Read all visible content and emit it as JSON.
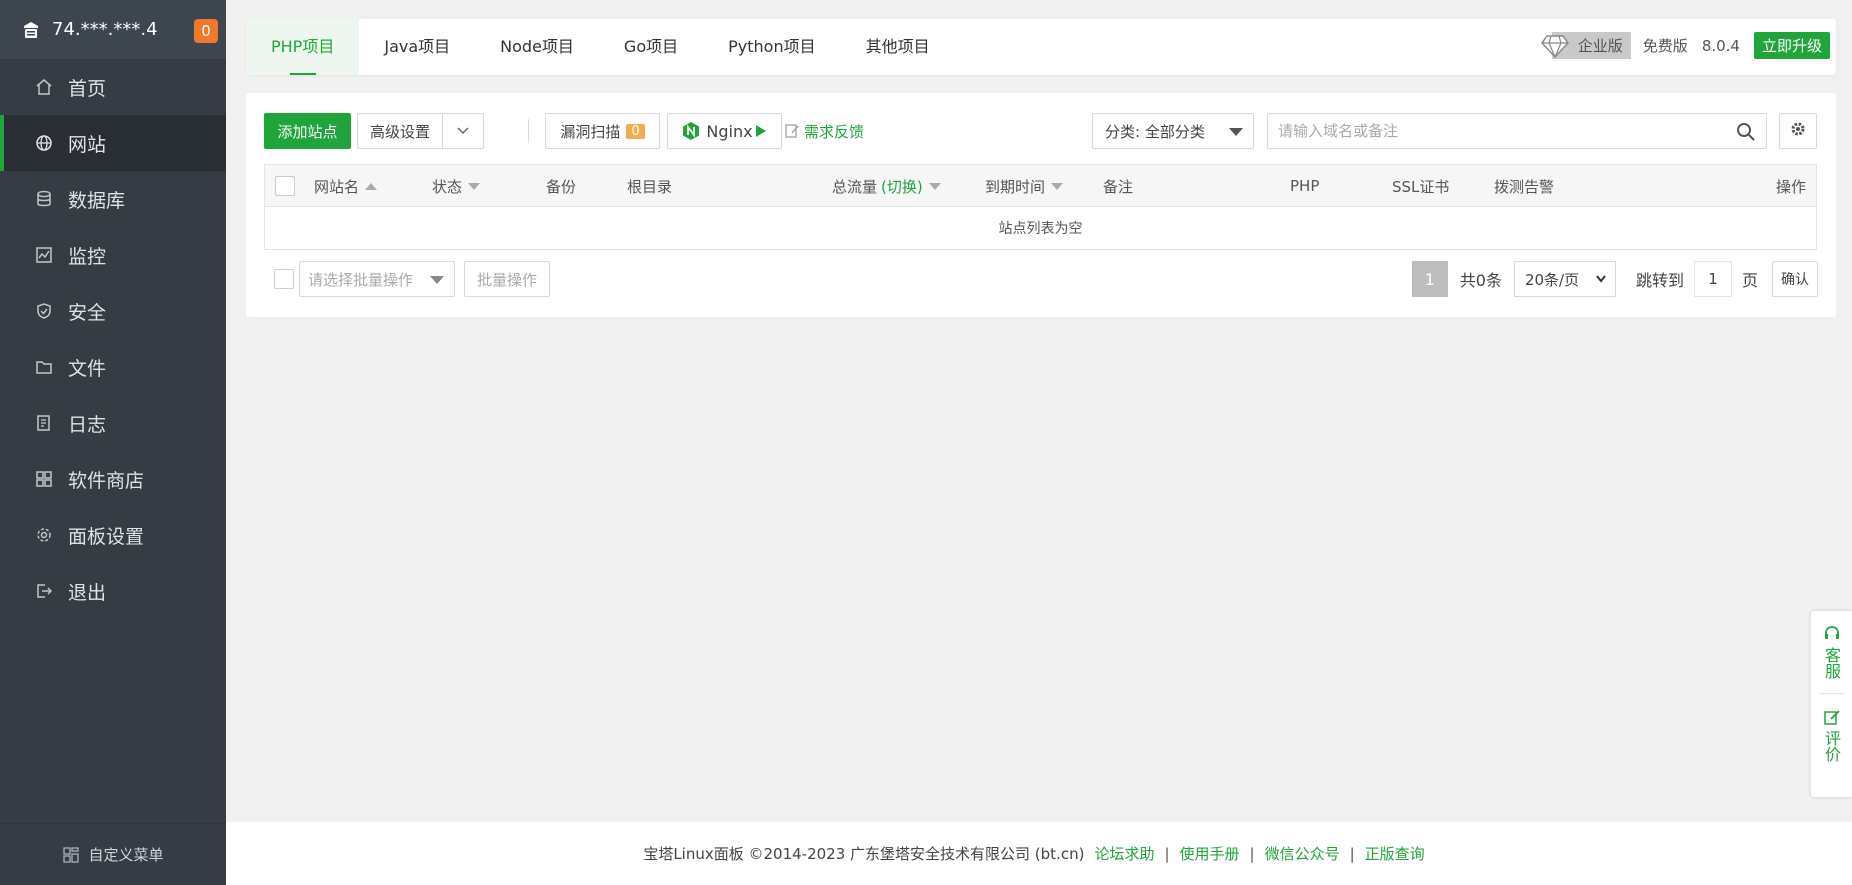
{
  "sidebar": {
    "host": "74.***.***.4",
    "badge": "0",
    "items": [
      {
        "label": "首页",
        "icon": "home-icon"
      },
      {
        "label": "网站",
        "icon": "globe-icon"
      },
      {
        "label": "数据库",
        "icon": "database-icon"
      },
      {
        "label": "监控",
        "icon": "monitor-icon"
      },
      {
        "label": "安全",
        "icon": "shield-icon"
      },
      {
        "label": "文件",
        "icon": "folder-icon"
      },
      {
        "label": "日志",
        "icon": "log-icon"
      },
      {
        "label": "软件商店",
        "icon": "apps-icon"
      },
      {
        "label": "面板设置",
        "icon": "gear-icon"
      },
      {
        "label": "退出",
        "icon": "logout-icon"
      }
    ],
    "custom_menu": "自定义菜单"
  },
  "topbar": {
    "tabs": [
      "PHP项目",
      "Java项目",
      "Node项目",
      "Go项目",
      "Python项目",
      "其他项目"
    ],
    "enterprise": "企业版",
    "free": "免费版",
    "version": "8.0.4",
    "upgrade": "立即升级"
  },
  "toolbar": {
    "add_site": "添加站点",
    "advanced": "高级设置",
    "scan": "漏洞扫描",
    "scan_count": "0",
    "nginx": "Nginx",
    "feedback": "需求反馈",
    "category": "分类: 全部分类",
    "search_placeholder": "请输入域名或备注"
  },
  "table": {
    "headers": {
      "name": "网站名",
      "status": "状态",
      "backup": "备份",
      "root": "根目录",
      "traffic": "总流量",
      "traffic_switch": "(切换)",
      "expire": "到期时间",
      "note": "备注",
      "php": "PHP",
      "ssl": "SSL证书",
      "alert": "拨测告警",
      "ops": "操作"
    },
    "empty": "站点列表为空"
  },
  "batch": {
    "placeholder": "请选择批量操作",
    "button": "批量操作"
  },
  "pager": {
    "current": "1",
    "total": "共0条",
    "page_size": "20条/页",
    "jump_label": "跳转到",
    "jump_value": "1",
    "page_unit": "页",
    "confirm": "确认"
  },
  "footer": {
    "copyright": "宝塔Linux面板 ©2014-2023 广东堡塔安全技术有限公司 (bt.cn)",
    "links": [
      "论坛求助",
      "使用手册",
      "微信公众号",
      "正版查询"
    ]
  },
  "float_side": {
    "service": "客服",
    "rate": "评价"
  },
  "colors": {
    "brand_green": "#20a53a",
    "sidebar_bg": "#353c44",
    "badge_orange": "#f0782d"
  }
}
